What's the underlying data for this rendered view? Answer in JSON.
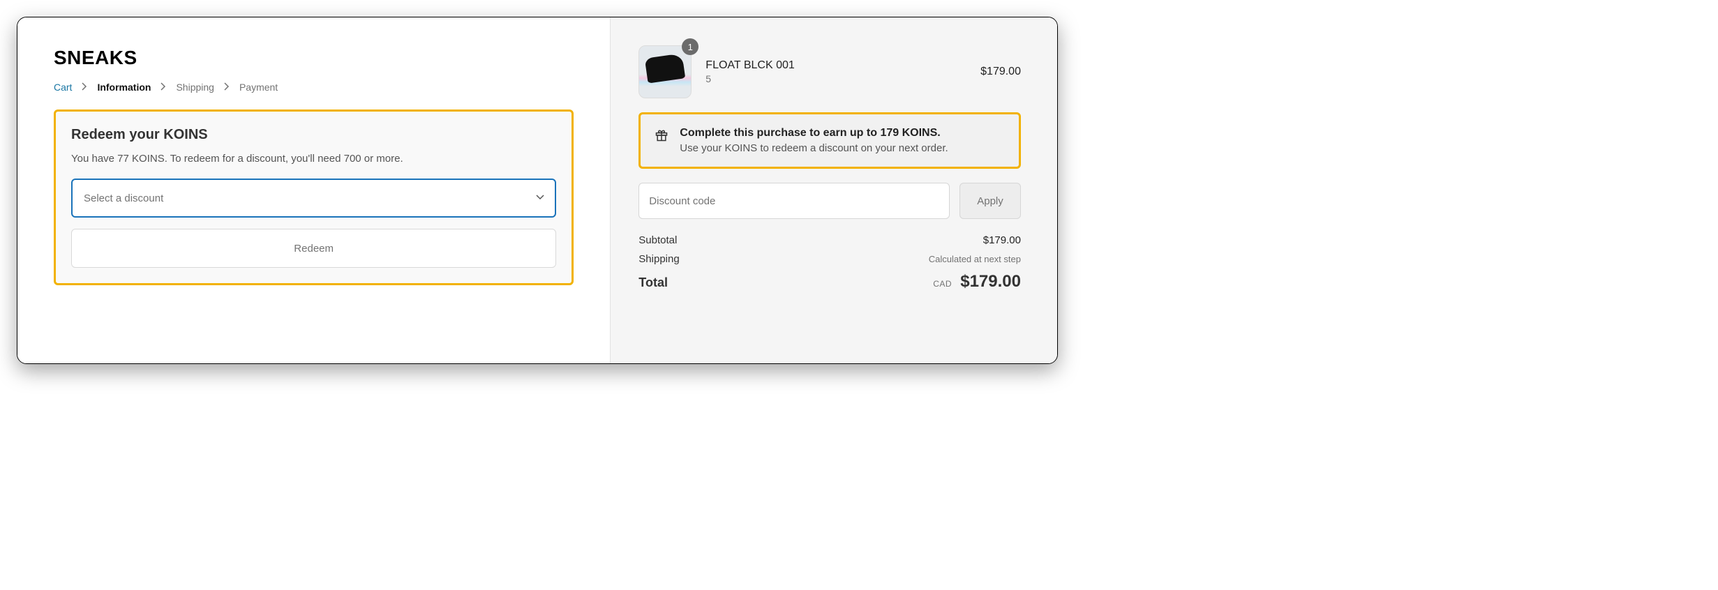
{
  "brand": "SNEAKS",
  "breadcrumb": {
    "cart": "Cart",
    "information": "Information",
    "shipping": "Shipping",
    "payment": "Payment"
  },
  "redeem": {
    "title": "Redeem your KOINS",
    "description": "You have 77 KOINS. To redeem for a discount, you'll need 700 or more.",
    "select_placeholder": "Select a discount",
    "button": "Redeem"
  },
  "product": {
    "name": "FLOAT BLCK 001",
    "variant": "5",
    "qty": "1",
    "price": "$179.00"
  },
  "earn": {
    "title": "Complete this purchase to earn up to 179 KOINS.",
    "description": "Use your KOINS to redeem a discount on your next order."
  },
  "discount": {
    "placeholder": "Discount code",
    "apply": "Apply"
  },
  "totals": {
    "subtotal_label": "Subtotal",
    "subtotal_value": "$179.00",
    "shipping_label": "Shipping",
    "shipping_value": "Calculated at next step",
    "total_label": "Total",
    "currency": "CAD",
    "total_value": "$179.00"
  }
}
